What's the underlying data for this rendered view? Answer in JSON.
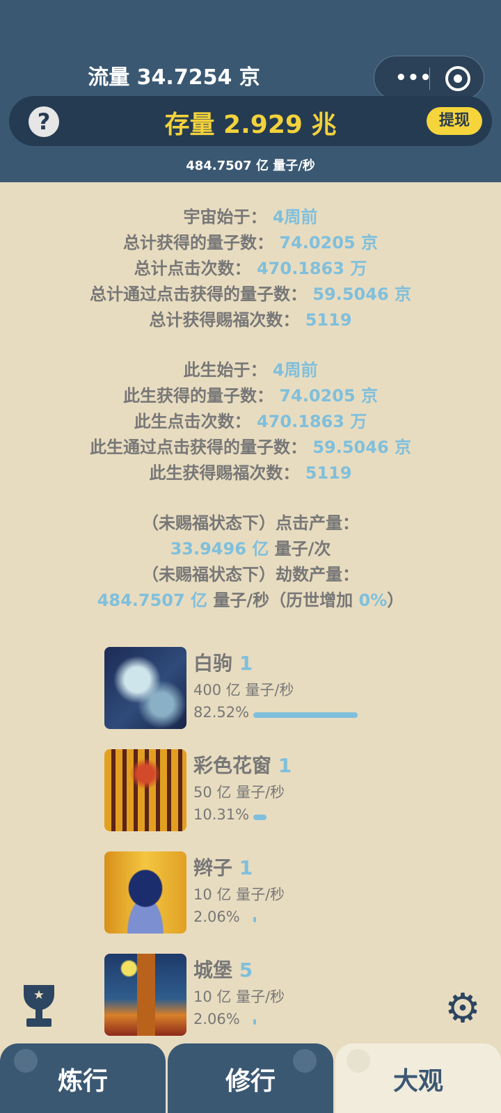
{
  "header": {
    "flow_label": "流量 34.7254 京",
    "capsule": {
      "more_icon": "more-dots-icon",
      "close_icon": "target-close-icon"
    },
    "help_label": "?",
    "stock_label": "存量 2.929 兆",
    "withdraw_label": "提现",
    "rate_label": "484.7507 亿  量子/秒"
  },
  "stats_total": [
    {
      "label": "宇宙始于：",
      "value": "4周前"
    },
    {
      "label": "总计获得的量子数：",
      "value": "74.0205 京"
    },
    {
      "label": "总计点击次数：",
      "value": "470.1863 万"
    },
    {
      "label": "总计通过点击获得的量子数：",
      "value": "59.5046 京"
    },
    {
      "label": "总计获得赐福次数：",
      "value": "5119"
    }
  ],
  "stats_life": [
    {
      "label": "此生始于：",
      "value": "4周前"
    },
    {
      "label": "此生获得的量子数：",
      "value": "74.0205 京"
    },
    {
      "label": "此生点击次数：",
      "value": "470.1863 万"
    },
    {
      "label": "此生通过点击获得的量子数：",
      "value": "59.5046 京"
    },
    {
      "label": "此生获得赐福次数：",
      "value": "5119"
    }
  ],
  "production": {
    "click_title": "（未赐福状态下）点击产量：",
    "click_value": "33.9496 亿",
    "click_unit": " 量子/次",
    "kalpa_title": "（未赐福状态下）劫数产量：",
    "kalpa_value": "484.7507 亿",
    "kalpa_unit": " 量子/秒（历世增加 ",
    "kalpa_bonus": "0%",
    "kalpa_close": "）"
  },
  "generators": [
    {
      "name": "白驹",
      "count": "1",
      "rate": "400 亿 量子/秒",
      "percent": "82.52%",
      "share": 0.8252
    },
    {
      "name": "彩色花窗",
      "count": "1",
      "rate": "50 亿  量子/秒",
      "percent": "10.31%",
      "share": 0.1031
    },
    {
      "name": "辫子",
      "count": "1",
      "rate": "10 亿  量子/秒",
      "percent": "2.06%",
      "share": 0.0206
    },
    {
      "name": "城堡",
      "count": "5",
      "rate": "10 亿  量子/秒",
      "percent": "2.06%",
      "share": 0.0206
    }
  ],
  "tabs": [
    {
      "label": "炼行",
      "active": false
    },
    {
      "label": "修行",
      "active": false
    },
    {
      "label": "大观",
      "active": true
    }
  ],
  "icons": {
    "trophy": "trophy-icon",
    "settings": "gear-icon"
  },
  "colors": {
    "header": "#3b5873",
    "stock": "#f3d23c",
    "value": "#7fbfdc",
    "background": "#e8dcc0"
  }
}
